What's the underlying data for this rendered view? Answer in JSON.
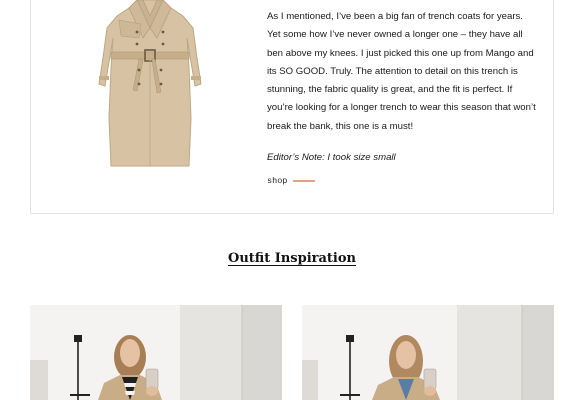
{
  "product": {
    "description": "As I mentioned, I’ve been a big fan of trench coats for years. Yet some how I’ve never owned a longer one – they have all ben above my knees. I just picked this one up from Mango and its SO GOOD. Truly. The attention to detail on this trench is stunning, the fabric quality is great, and the fit is perfect. If you’re looking for a longer trench to wear this season that won’t break the bank, this one is a must!",
    "editors_note": "Editor’s Note: I took size small",
    "shop_label": "shop",
    "accent_color": "#e7a37b"
  },
  "section": {
    "title": "Outfit Inspiration"
  }
}
